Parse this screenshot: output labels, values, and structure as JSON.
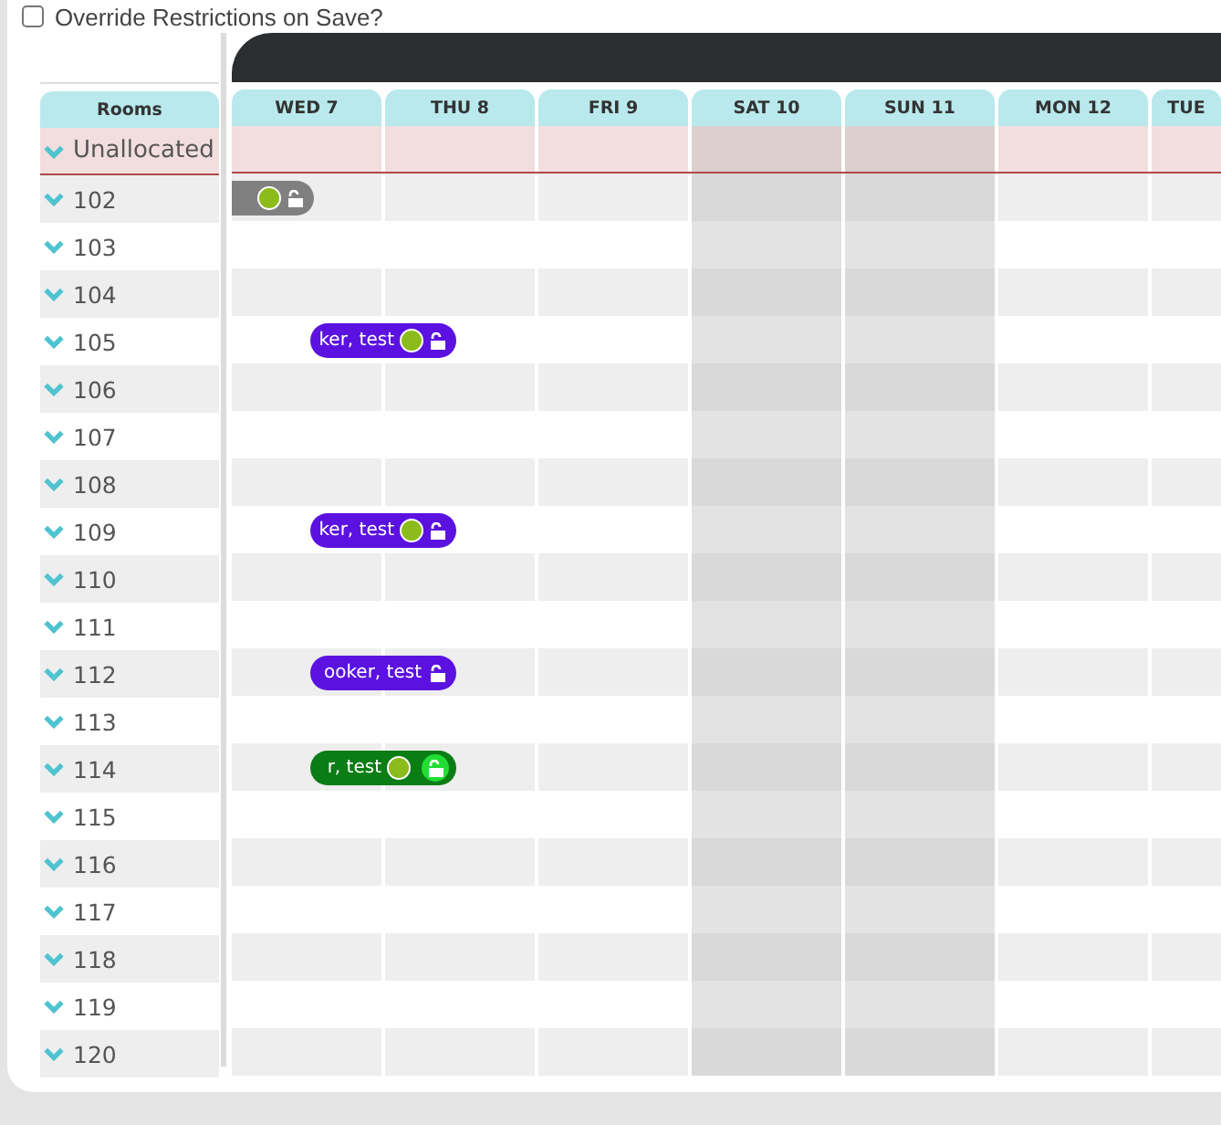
{
  "override": {
    "label": "Override Restrictions on Save?",
    "checked": false
  },
  "rooms_header": "Rooms",
  "days": [
    {
      "label": "WED 7",
      "weekend": false
    },
    {
      "label": "THU 8",
      "weekend": false
    },
    {
      "label": "FRI 9",
      "weekend": false
    },
    {
      "label": "SAT 10",
      "weekend": true
    },
    {
      "label": "SUN 11",
      "weekend": true
    },
    {
      "label": "MON 12",
      "weekend": false
    },
    {
      "label": "TUE",
      "weekend": false
    }
  ],
  "rows": [
    {
      "room": "Unallocated",
      "kind": "unallocated"
    },
    {
      "room": "102",
      "kind": "room",
      "booking": {
        "color": "#808080",
        "dot": true,
        "lock_badge": false
      }
    },
    {
      "room": "103",
      "kind": "room"
    },
    {
      "room": "104",
      "kind": "room"
    },
    {
      "room": "105",
      "kind": "room",
      "booking": {
        "label": "ker, test",
        "color": "#5b12e0",
        "dot": true,
        "lock_badge": false
      }
    },
    {
      "room": "106",
      "kind": "room"
    },
    {
      "room": "107",
      "kind": "room"
    },
    {
      "room": "108",
      "kind": "room"
    },
    {
      "room": "109",
      "kind": "room",
      "booking": {
        "label": "ker, test",
        "color": "#5b12e0",
        "dot": true,
        "lock_badge": false
      }
    },
    {
      "room": "110",
      "kind": "room"
    },
    {
      "room": "111",
      "kind": "room"
    },
    {
      "room": "112",
      "kind": "room",
      "booking": {
        "label": "ooker, test",
        "color": "#5b12e0",
        "dot": false,
        "lock_badge": false
      }
    },
    {
      "room": "113",
      "kind": "room"
    },
    {
      "room": "114",
      "kind": "room",
      "booking": {
        "label": "r, test",
        "color": "#0a7d14",
        "dot": true,
        "lock_badge": true
      }
    },
    {
      "room": "115",
      "kind": "room"
    },
    {
      "room": "116",
      "kind": "room"
    },
    {
      "room": "117",
      "kind": "room"
    },
    {
      "room": "118",
      "kind": "room"
    },
    {
      "room": "119",
      "kind": "room"
    },
    {
      "room": "120",
      "kind": "room"
    }
  ]
}
